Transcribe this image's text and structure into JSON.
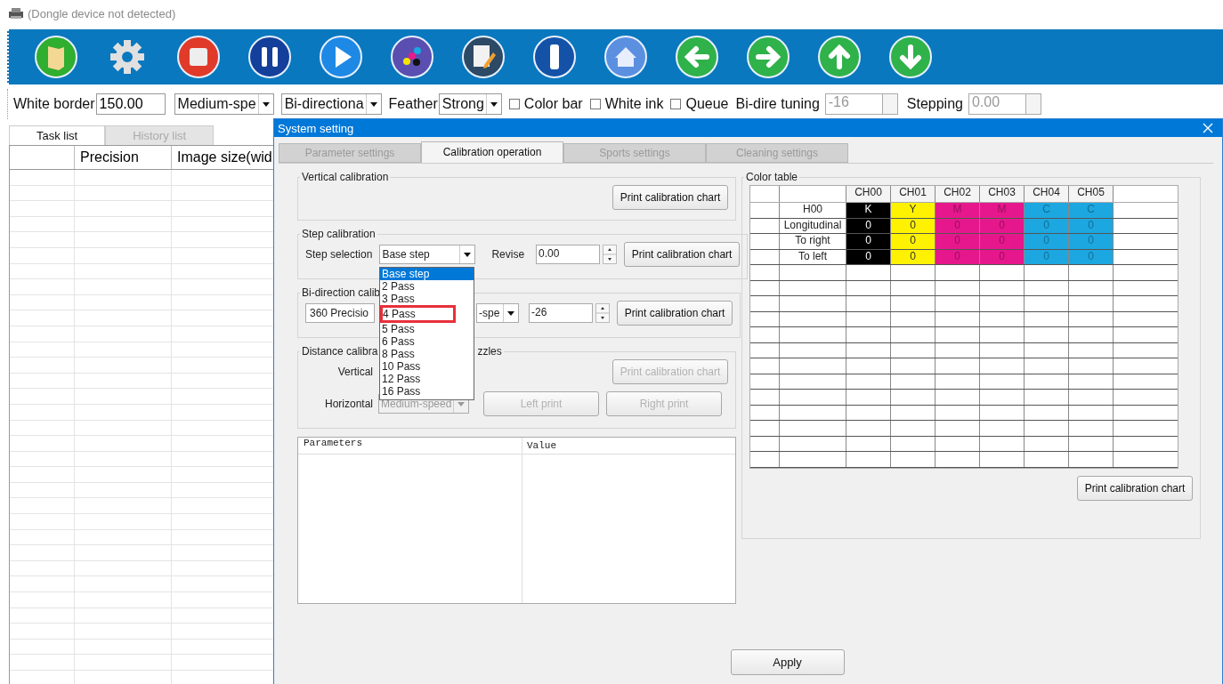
{
  "app_title": "(Dongle device not detected)",
  "toolbar": [
    {
      "kind": "folder"
    },
    {
      "kind": "gear"
    },
    {
      "kind": "stop"
    },
    {
      "kind": "pause"
    },
    {
      "kind": "play"
    },
    {
      "kind": "ink"
    },
    {
      "kind": "edit"
    },
    {
      "kind": "bottle"
    },
    {
      "kind": "home"
    },
    {
      "kind": "left"
    },
    {
      "kind": "right"
    },
    {
      "kind": "up"
    },
    {
      "kind": "down"
    }
  ],
  "options": {
    "white_border_label": "White border",
    "white_border_value": "150.00",
    "speed": "Medium-spe",
    "direction": "Bi-directiona",
    "feather_label": "Feather",
    "feather": "Strong",
    "checkboxes": [
      {
        "label": "Color bar",
        "checked": false
      },
      {
        "label": "White ink",
        "checked": false
      },
      {
        "label": "Queue",
        "checked": false
      }
    ],
    "bi_dire_label": "Bi-dire tuning",
    "bi_dire_value": "-16",
    "stepping_label": "Stepping",
    "stepping_value": "0.00"
  },
  "main_tabs": [
    {
      "label": "Task list",
      "selected": true
    },
    {
      "label": "History list",
      "selected": false
    }
  ],
  "task_table": {
    "columns": [
      "Precision",
      "Image size(wid"
    ]
  },
  "dialog": {
    "title": "System setting",
    "tabs": [
      {
        "label": "Parameter settings",
        "selected": false
      },
      {
        "label": "Calibration operation",
        "selected": true
      },
      {
        "label": "Sports settings",
        "selected": false
      },
      {
        "label": "Cleaning settings",
        "selected": false
      }
    ],
    "vertical_calibration": {
      "legend": "Vertical calibration",
      "button": {
        "label": "Print calibration chart",
        "disabled": false
      }
    },
    "step_calibration": {
      "legend": "Step calibration",
      "step_label": "Step selection",
      "step_value": "Base step",
      "revise_label": "Revise",
      "revise_value": "0.00",
      "button": {
        "label": "Print calibration chart",
        "disabled": false
      }
    },
    "step_dropdown": [
      {
        "label": "Base step",
        "selected": true,
        "highlighted": false
      },
      {
        "label": "2 Pass",
        "selected": false,
        "highlighted": false
      },
      {
        "label": "3 Pass",
        "selected": false,
        "highlighted": false
      },
      {
        "label": "4 Pass",
        "selected": false,
        "highlighted": true
      },
      {
        "label": "5 Pass",
        "selected": false,
        "highlighted": false
      },
      {
        "label": "6 Pass",
        "selected": false,
        "highlighted": false
      },
      {
        "label": "8 Pass",
        "selected": false,
        "highlighted": false
      },
      {
        "label": "10 Pass",
        "selected": false,
        "highlighted": false
      },
      {
        "label": "12 Pass",
        "selected": false,
        "highlighted": false
      },
      {
        "label": "16 Pass",
        "selected": false,
        "highlighted": false
      }
    ],
    "bidirection": {
      "legend": "Bi-direction calib",
      "precision": "360 Precisio",
      "speed": "-spe",
      "value": "-26",
      "button": {
        "label": "Print calibration chart",
        "disabled": false
      }
    },
    "distance": {
      "legend_start": "Distance calibra",
      "legend_end": "zzles",
      "vertical_label": "Vertical",
      "vertical_button": {
        "label": "Print calibration chart",
        "disabled": true
      },
      "horizontal_label": "Horizontal",
      "horizontal_value": "Medium-speed",
      "horizontal_disabled": true,
      "left_button": {
        "label": "Left print",
        "disabled": true
      },
      "right_button": {
        "label": "Right print",
        "disabled": true
      }
    },
    "param_table": {
      "columns": [
        "Parameters",
        "Value"
      ]
    },
    "color_table": {
      "legend": "Color table",
      "channels": [
        {
          "name": "CH00",
          "color": "#000000"
        },
        {
          "name": "CH01",
          "color": "#fff200"
        },
        {
          "name": "CH02",
          "color": "#e6178c"
        },
        {
          "name": "CH03",
          "color": "#e6178c"
        },
        {
          "name": "CH04",
          "color": "#1ca7e0"
        },
        {
          "name": "CH05",
          "color": "#1ca7e0"
        }
      ],
      "rows": [
        {
          "label": "H00",
          "cells": [
            "K",
            "Y",
            "M",
            "M",
            "C",
            "C"
          ]
        },
        {
          "label": "Longitudinal",
          "cells": [
            "0",
            "0",
            "0",
            "0",
            "0",
            "0"
          ]
        },
        {
          "label": "To right",
          "cells": [
            "0",
            "0",
            "0",
            "0",
            "0",
            "0"
          ]
        },
        {
          "label": "To left",
          "cells": [
            "0",
            "0",
            "0",
            "0",
            "0",
            "0"
          ]
        }
      ],
      "button": {
        "label": "Print calibration chart",
        "disabled": false
      }
    },
    "apply": "Apply"
  }
}
